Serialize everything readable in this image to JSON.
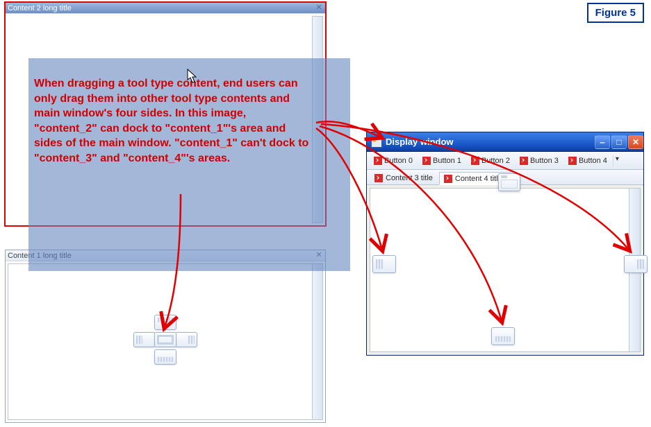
{
  "figure_label": "Figure 5",
  "content2": {
    "title": "Content 2 long title"
  },
  "content1": {
    "title": "Content 1 long title"
  },
  "annotation": "When dragging a tool type content, end users can only drag them into other tool type contents and main window's four sides. In this image, \"content_2\" can dock to \"content_1\"'s area and sides of the main window. \"content_1\" can't dock to \"content_3\" and \"content_4\"'s areas.",
  "display_window": {
    "title": "Display window",
    "toolbar": [
      "Button 0",
      "Button 1",
      "Button 2",
      "Button 3",
      "Button 4"
    ],
    "tabs": [
      {
        "label": "Content 3 title",
        "active": false
      },
      {
        "label": "Content 4 title",
        "active": true
      }
    ]
  },
  "colors": {
    "annotation_red": "#d10000",
    "selection_blue": "rgba(96,131,189,0.58)",
    "xp_title_gradient_top": "#3a80e8",
    "xp_title_gradient_bottom": "#0f3fa0"
  }
}
